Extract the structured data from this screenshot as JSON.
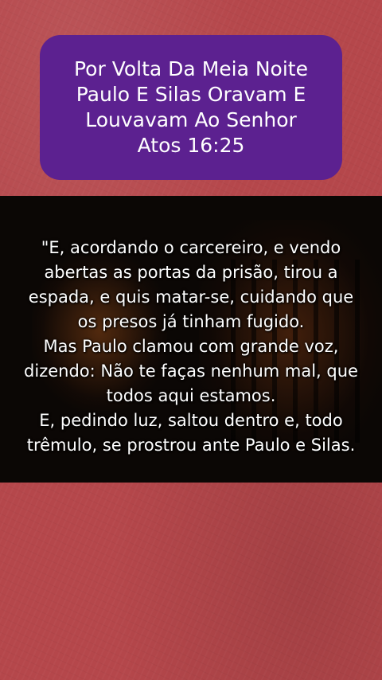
{
  "title": {
    "lines": [
      "Por Volta Da Meia Noite",
      "Paulo E Silas Oravam E",
      "Louvavam Ao Senhor",
      "Atos 16:25"
    ]
  },
  "verse": {
    "lines": [
      "\"E, acordando o carcereiro, e vendo",
      "abertas as portas da prisão, tirou a",
      "espada, e quis matar-se, cuidando que",
      "os presos já tinham fugido.",
      "Mas Paulo clamou com grande voz,",
      "dizendo: Não te faças nenhum mal, que",
      "todos aqui estamos.",
      "E, pedindo luz, saltou dentro e, todo",
      "trêmulo, se prostrou ante Paulo e Silas."
    ]
  },
  "colors": {
    "background": "#b5474b",
    "title_box": "#5c2190",
    "video_panel": "#0b0705",
    "text": "#ffffff"
  }
}
